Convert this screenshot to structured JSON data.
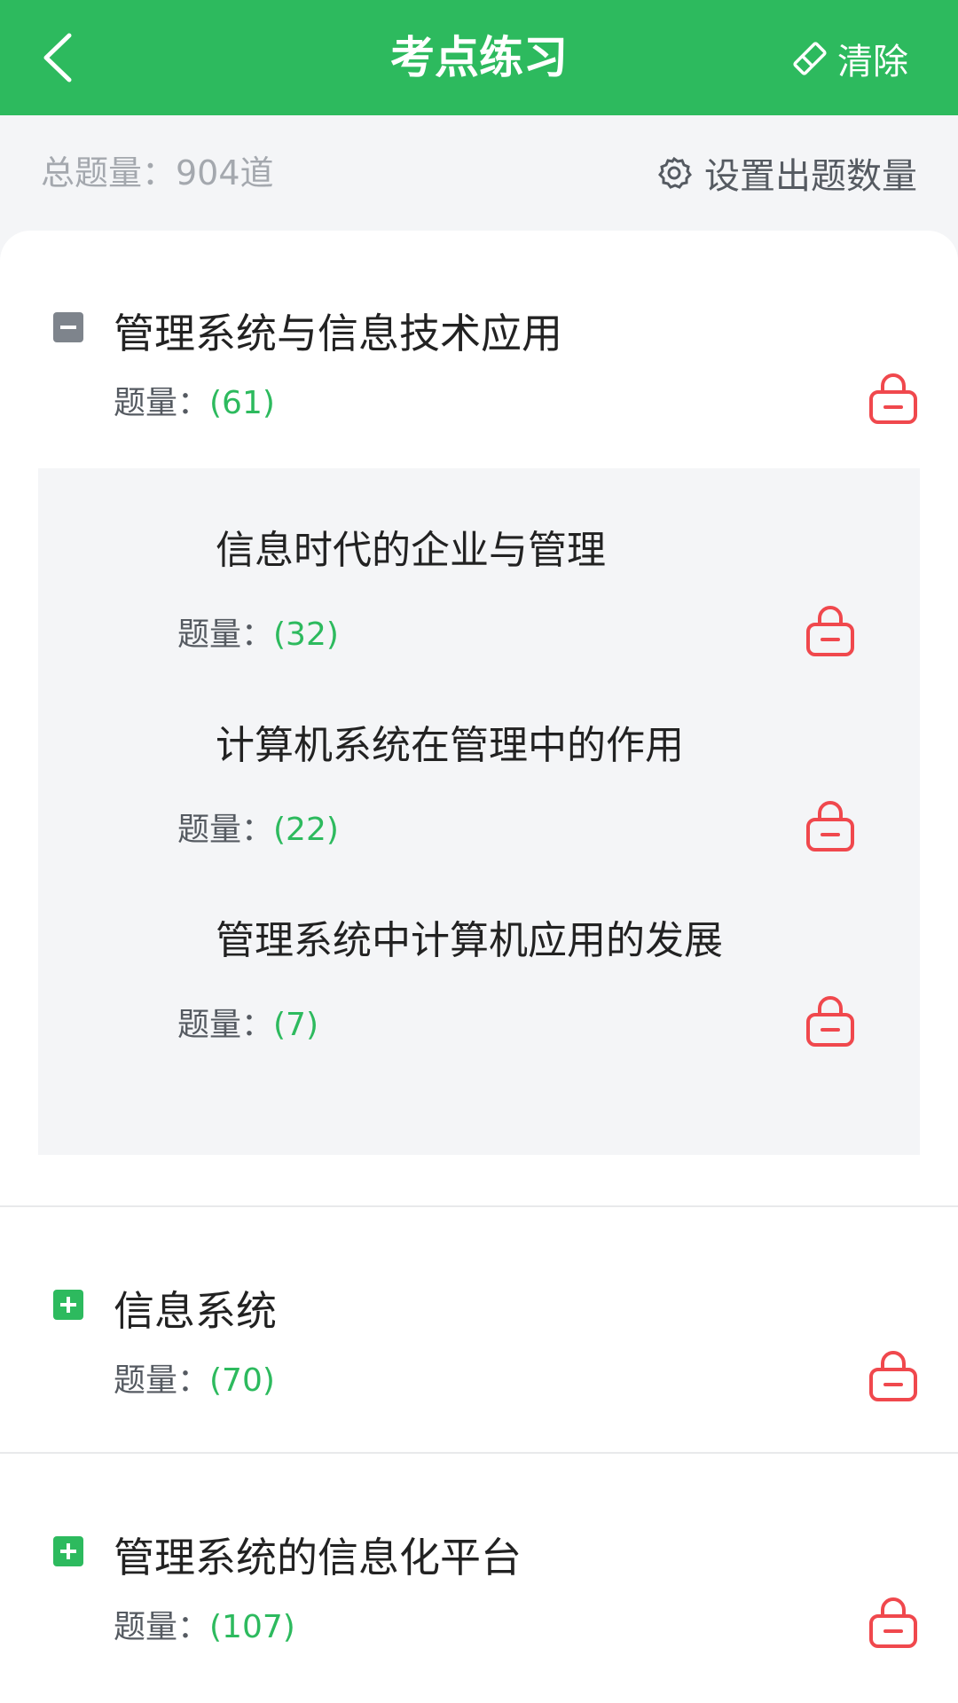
{
  "header": {
    "title": "考点练习",
    "clear_label": "清除"
  },
  "summary": {
    "total_text": "总题量：904道",
    "settings_label": "设置出题数量"
  },
  "sections": [
    {
      "title": "管理系统与信息技术应用",
      "count_label": "题量：",
      "count_value": "(61)",
      "expanded": true,
      "children": [
        {
          "title": "信息时代的企业与管理",
          "count_label": "题量：",
          "count_value": "(32)"
        },
        {
          "title": "计算机系统在管理中的作用",
          "count_label": "题量：",
          "count_value": "(22)"
        },
        {
          "title": "管理系统中计算机应用的发展",
          "count_label": "题量：",
          "count_value": "(7)"
        }
      ]
    },
    {
      "title": "信息系统",
      "count_label": "题量：",
      "count_value": "(70)",
      "expanded": false
    },
    {
      "title": "管理系统的信息化平台",
      "count_label": "题量：",
      "count_value": "(107)",
      "expanded": false
    }
  ],
  "icons": {
    "back": "chevron-left-icon",
    "clear": "eraser-icon",
    "settings": "gear-icon",
    "collapse": "minus-square-icon",
    "expand": "plus-square-icon",
    "lock": "lock-icon"
  },
  "colors": {
    "brand_green": "#2dba5e",
    "lock_red": "#f0484d",
    "collapse_gray": "#7e848c",
    "count_green": "#2dba5e"
  }
}
